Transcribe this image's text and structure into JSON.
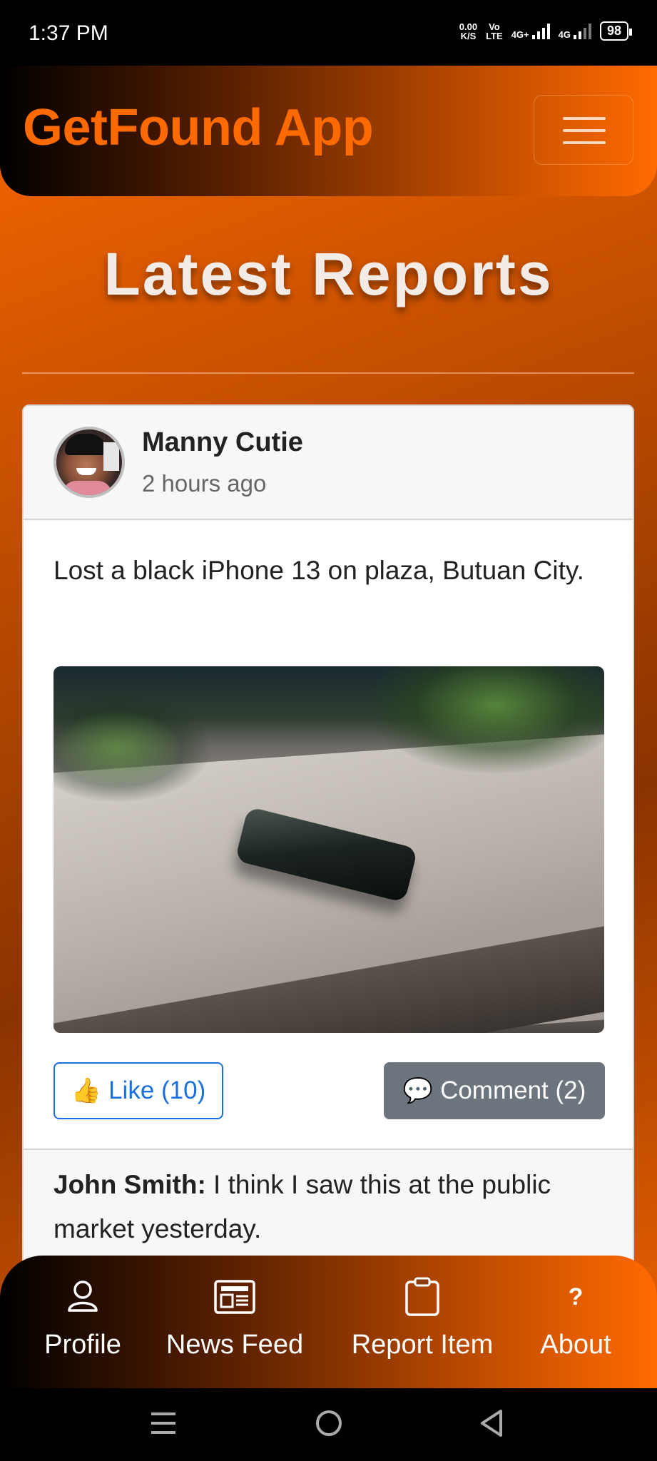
{
  "status_bar": {
    "time": "1:37 PM",
    "net_speed_value": "0.00",
    "net_speed_unit": "K/S",
    "volte_top": "Vo",
    "volte_bottom": "LTE",
    "network1": "4G+",
    "network2": "4G",
    "battery": "98"
  },
  "header": {
    "brand": "GetFound App",
    "menu_icon": "hamburger-icon"
  },
  "page": {
    "title": "Latest Reports"
  },
  "post": {
    "author": "Manny Cutie",
    "time_ago": "2 hours ago",
    "text": "Lost a black iPhone 13 on plaza, Butuan City.",
    "like_emoji": "👍",
    "like_label": "Like (10)",
    "comment_emoji": "💬",
    "comment_label": "Comment (2)",
    "comments": [
      {
        "author": "John Smith:",
        "text": " I think I saw this at the public market yesterday."
      }
    ]
  },
  "bottom_nav": {
    "items": [
      {
        "label": "Profile",
        "icon": "person-icon"
      },
      {
        "label": "News Feed",
        "icon": "newspaper-icon"
      },
      {
        "label": "Report Item",
        "icon": "clipboard-icon"
      },
      {
        "label": "About",
        "icon": "question-icon",
        "glyph": "?"
      }
    ]
  },
  "colors": {
    "brand": "#ff6a00",
    "primary": "#1b6fe0",
    "secondary": "#6c757d"
  }
}
